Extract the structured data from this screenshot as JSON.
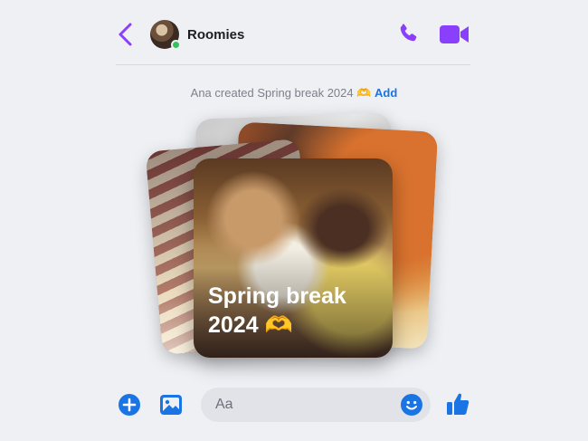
{
  "header": {
    "title": "Roomies",
    "back_icon": "chevron-left-icon",
    "call_icon": "phone-icon",
    "video_icon": "video-camera-icon",
    "accent_color": "#8a3ffc",
    "online_color": "#31c45a"
  },
  "system_message": {
    "text": "Ana created Spring break 2024 🫶",
    "action_label": "Add",
    "action_color": "#1b74e4"
  },
  "album": {
    "title": "Spring break 2024 🫶"
  },
  "composer": {
    "placeholder": "Aa",
    "plus_icon": "plus-circle-icon",
    "image_icon": "image-icon",
    "emoji_icon": "smiley-icon",
    "like_icon": "thumbs-up-icon",
    "accent_color": "#1b74e4"
  }
}
